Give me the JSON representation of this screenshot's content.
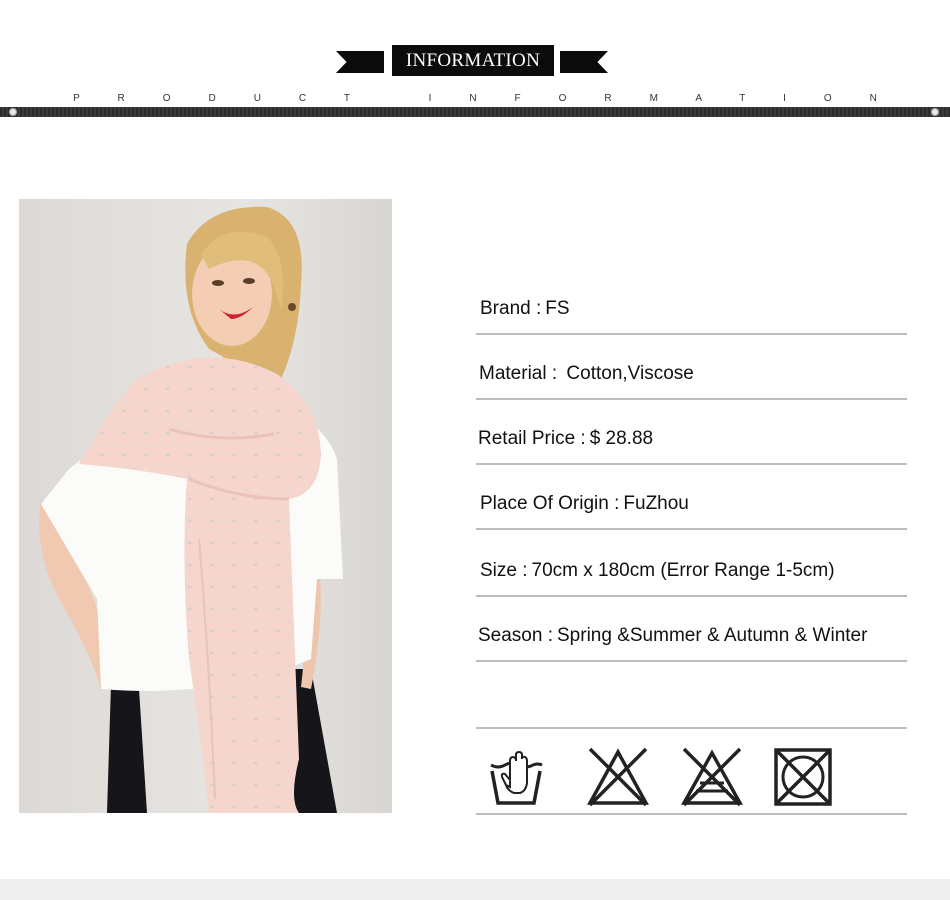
{
  "header": {
    "title": "INFORMATION",
    "subtitle": "P R O D U C T   I N F O R M A T I O N"
  },
  "product_photo": {
    "alt": "woman wearing pink scarf"
  },
  "specs": [
    {
      "label": "Brand :",
      "value": "FS"
    },
    {
      "label": "Material : ",
      "value": "Cotton,Viscose"
    },
    {
      "label": "Retail Price :",
      "value": "$ 28.88"
    },
    {
      "label": "Place Of Origin :",
      "value": "FuZhou"
    },
    {
      "label": "Size :",
      "value": "70cm x 180cm (Error Range 1-5cm)"
    },
    {
      "label": "Season :",
      "value": "Spring &Summer & Autumn & Winter"
    }
  ],
  "care_icons": [
    "hand-wash-icon",
    "do-not-bleach-icon",
    "do-not-tumble-dry-icon",
    "do-not-dry-clean-icon"
  ],
  "colors": {
    "banner": "#0b0b0b",
    "divider": "#bdbdbd",
    "scarf": "#f5d6cf",
    "photo_background": "#e4e1de"
  }
}
